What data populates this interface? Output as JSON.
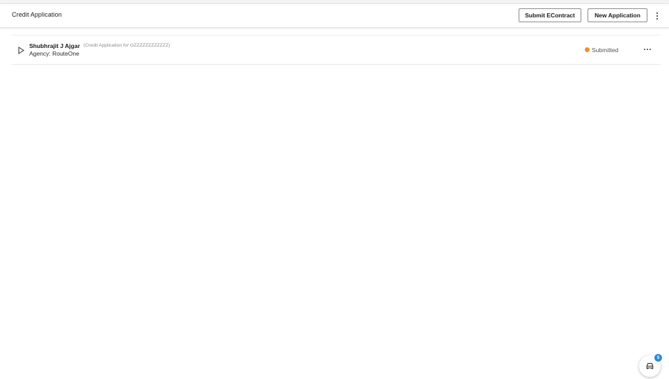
{
  "header": {
    "title": "Credit Application",
    "submit_econtract_label": "Submit EContract",
    "new_application_label": "New Application",
    "more_menu_icon": "vertical-ellipsis-icon"
  },
  "applications": [
    {
      "applicant_name": "Shubhrajit J Ajgar",
      "description": "(Credit Application for GZZZZZZZZZZZZ)",
      "agency": "Agency: RouteOne",
      "status": "Submitted",
      "status_color": "#f0902f",
      "expand_icon": "triangle-right-icon",
      "row_menu_icon": "horizontal-ellipsis-icon"
    }
  ],
  "assistant_button": {
    "icon": "car-icon",
    "badge_count": "5",
    "badge_color": "#2f8bd6"
  }
}
